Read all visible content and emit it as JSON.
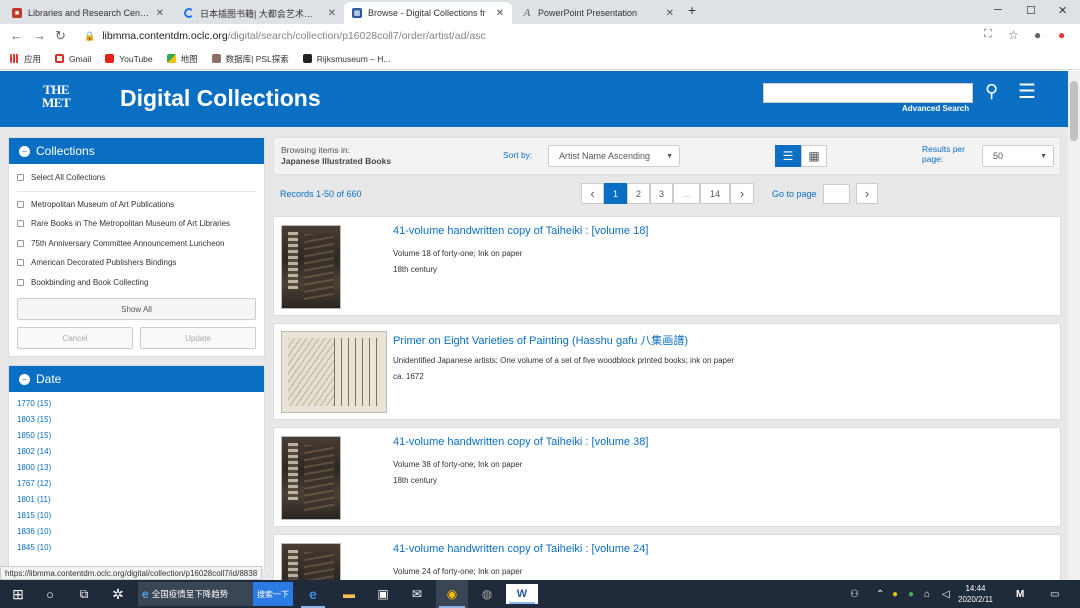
{
  "browser": {
    "tabs": [
      {
        "title": "Libraries and Research Center",
        "icon": "met-libraries-favicon",
        "color": "#c0392b"
      },
      {
        "title": "日本插图书籍| 大都会艺术博物馆",
        "icon": "loading-spinner-icon",
        "color": "#1a73e8"
      },
      {
        "title": "Browse - Digital Collections fr",
        "icon": "contentdm-favicon",
        "color": "#2c5aa0",
        "active": true
      },
      {
        "title": "PowerPoint Presentation",
        "icon": "document-a-icon",
        "color": "#5f6368"
      }
    ],
    "new_tab": "+",
    "window_controls": {
      "minimize": "─",
      "maximize": "☐",
      "close": "✕"
    },
    "url_host": "libmma.contentdm.oclc.org",
    "url_path": "/digital/search/collection/p16028coll7/order/artist/ad/asc",
    "bookmarks": [
      {
        "label": "应用",
        "icon": "apps-grid-icon"
      },
      {
        "label": "Gmail",
        "icon": "gmail-icon"
      },
      {
        "label": "YouTube",
        "icon": "youtube-icon"
      },
      {
        "label": "地图",
        "icon": "maps-icon"
      },
      {
        "label": "数据库| PSL探索",
        "icon": "psl-icon"
      },
      {
        "label": "Rijksmuseum – H...",
        "icon": "rijksmuseum-icon"
      }
    ]
  },
  "header": {
    "logo_line1": "THE",
    "logo_line2": "MET",
    "site_title": "Digital Collections",
    "search_placeholder": "",
    "advanced_search": "Advanced Search"
  },
  "collections_panel": {
    "title": "Collections",
    "select_all": "Select All Collections",
    "items": [
      "Metropolitan Museum of Art Publications",
      "Rare Books in The Metropolitan Museum of Art Libraries",
      "75th Anniversary Committee Announcement Luncheon",
      "American Decorated Publishers Bindings",
      "Bookbinding and Book Collecting"
    ],
    "show_all": "Show All",
    "cancel": "Cancel",
    "update": "Update"
  },
  "date_panel": {
    "title": "Date",
    "items": [
      "1770 (15)",
      "1803 (15)",
      "1850 (15)",
      "1802 (14)",
      "1800 (13)",
      "1767 (12)",
      "1801 (11)",
      "1815 (10)",
      "1836 (10)",
      "1845 (10)"
    ]
  },
  "main_toolbar": {
    "browsing_label": "Browsing items in:",
    "browsing_collection": "Japanese Illustrated Books",
    "sort_label": "Sort by:",
    "sort_value": "Artist Name Ascending",
    "results_label_1": "Results per",
    "results_label_2": "page:",
    "results_value": "50"
  },
  "pagination": {
    "records": "Records 1-50 of 660",
    "prev": "‹",
    "pages": [
      "1",
      "2",
      "3"
    ],
    "ellipsis": "...",
    "last": "14",
    "next": "›",
    "goto_label": "Go to page",
    "goto_value": "",
    "goto_btn": "›"
  },
  "results": [
    {
      "title": "41-volume handwritten copy of Taiheiki : [volume 18]",
      "desc": "Volume 18 of forty-one; Ink on paper",
      "date": "18th century"
    },
    {
      "title": "Primer on Eight Varieties of Painting (Hasshu gafu 八集画譜)",
      "desc": "Unidentified Japanese artists; One volume of a set of five woodblock printed books; ink on paper",
      "date": "ca. 1672"
    },
    {
      "title": "41-volume handwritten copy of Taiheiki : [volume 38]",
      "desc": "Volume 38 of forty-one; Ink on paper",
      "date": "18th century"
    },
    {
      "title": "41-volume handwritten copy of Taiheiki : [volume 24]",
      "desc": "Volume 24 of forty-one; Ink on paper",
      "date": ""
    }
  ],
  "status_url": "https://libmma.contentdm.oclc.org/digital/collection/p16028coll7/id/8838",
  "taskbar": {
    "app_label": "全国疫情呈下降趋势",
    "app_button": "搜索一下",
    "time": "14:44",
    "date": "2020/2/11"
  }
}
